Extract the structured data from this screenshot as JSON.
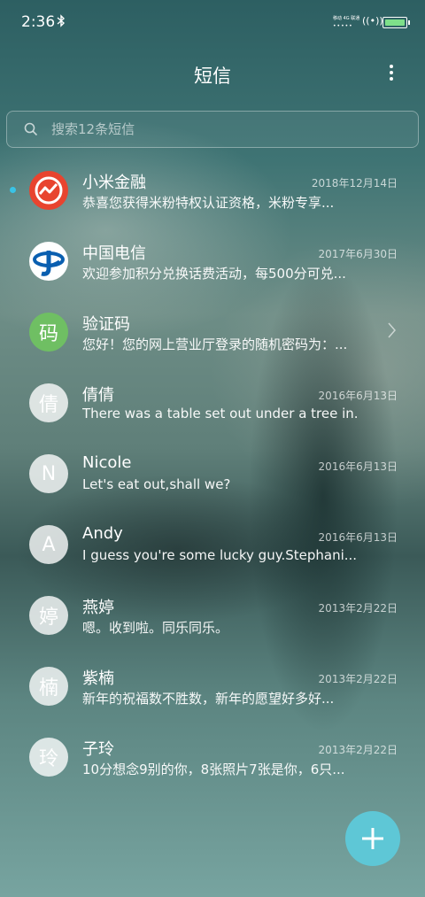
{
  "status": {
    "time": "2:36",
    "carrier_text": "移动 4G 联通",
    "signal_dots": "•••••"
  },
  "header": {
    "title": "短信"
  },
  "search": {
    "placeholder": "搜索12条短信"
  },
  "conversations": [
    {
      "name": "小米金融",
      "date": "2018年12月14日",
      "preview": "恭喜您获得米粉特权认证资格，米粉专享...",
      "avatar": "mi-finance-logo",
      "unread": true
    },
    {
      "name": "中国电信",
      "date": "2017年6月30日",
      "preview": "欢迎参加积分兑换话费活动，每500分可兑...",
      "avatar": "china-telecom-logo"
    },
    {
      "name": "验证码",
      "date": "",
      "preview": "您好！您的网上营业厅登录的随机密码为：...",
      "avatar_text": "码"
    },
    {
      "name": "倩倩",
      "date": "2016年6月13日",
      "preview": "There was a table set out under a tree in...",
      "avatar_text": "倩"
    },
    {
      "name": "Nicole",
      "date": "2016年6月13日",
      "preview": "Let's eat out,shall we?",
      "avatar_text": "N"
    },
    {
      "name": "Andy",
      "date": "2016年6月13日",
      "preview": "I guess you're some lucky guy.Stephani...",
      "avatar_text": "A"
    },
    {
      "name": "燕婷",
      "date": "2013年2月22日",
      "preview": "嗯。收到啦。同乐同乐。",
      "avatar_text": "婷"
    },
    {
      "name": "紫楠",
      "date": "2013年2月22日",
      "preview": "新年的祝福数不胜数，新年的愿望好多好...",
      "avatar_text": "楠"
    },
    {
      "name": "子玲",
      "date": "2013年2月22日",
      "preview": "10分想念9别的你，8张照片7张是你，6只...",
      "avatar_text": "玲"
    }
  ],
  "colors": {
    "accent": "#5ec7d6",
    "unread_dot": "#39c3e6",
    "mi_red": "#e8442f",
    "telecom_blue": "#0a5fb0",
    "code_green": "#6fbf63"
  }
}
